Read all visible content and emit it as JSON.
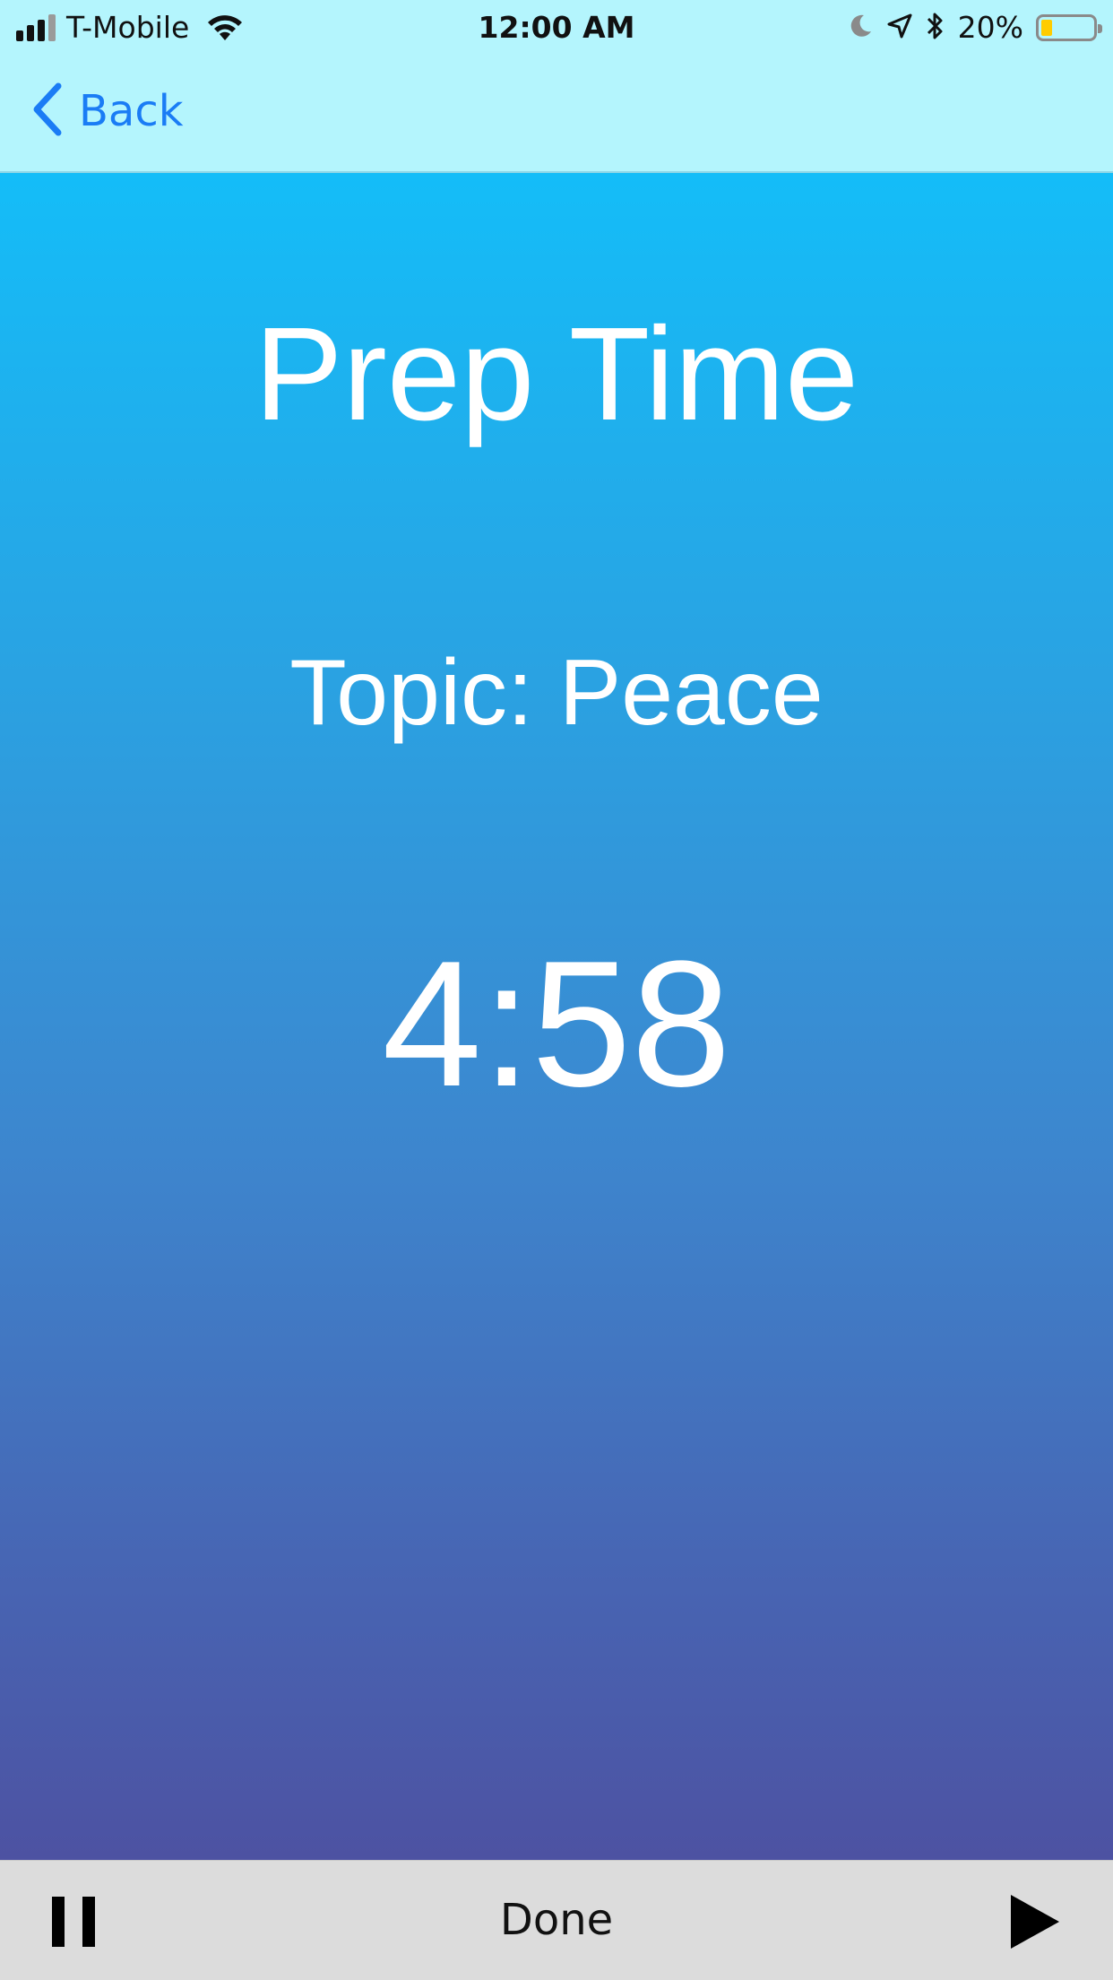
{
  "status_bar": {
    "carrier": "T-Mobile",
    "time": "12:00 AM",
    "battery_percent": "20%",
    "signal_bars_filled": 3,
    "signal_bars_total": 4,
    "icons": [
      "signal-icon",
      "wifi-icon",
      "moon-icon",
      "location-arrow-icon",
      "bluetooth-icon",
      "battery-icon"
    ],
    "battery_fill_color": "#ffcc00"
  },
  "nav": {
    "back_label": "Back",
    "back_color": "#1a7cf5"
  },
  "main": {
    "title": "Prep Time",
    "topic": "Topic: Peace",
    "timer": "4:58",
    "gradient_top": "#14bdf8",
    "gradient_bottom": "#4d52a2"
  },
  "toolbar": {
    "done_label": "Done",
    "icons": [
      "pause-icon",
      "play-icon"
    ]
  }
}
